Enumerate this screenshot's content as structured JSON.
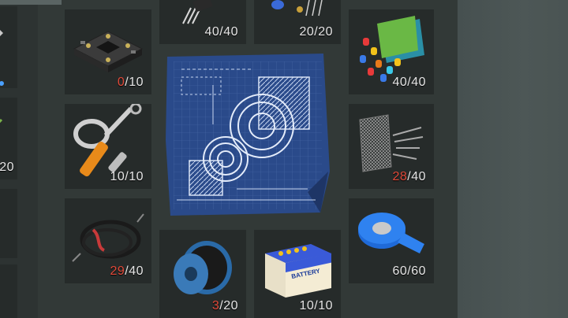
{
  "left_column": {
    "partial_count": "20"
  },
  "slots": [
    {
      "id": "transistors",
      "cur": "40",
      "max": "40",
      "low": false,
      "icon": "transistors-icon"
    },
    {
      "id": "capacitors",
      "cur": "20",
      "max": "20",
      "low": false,
      "icon": "capacitors-icon"
    },
    {
      "id": "circuit-board",
      "cur": "0",
      "max": "10",
      "low": true,
      "icon": "circuit-board-icon"
    },
    {
      "id": "plastic",
      "cur": "40",
      "max": "40",
      "low": false,
      "icon": "plastic-pieces-icon"
    },
    {
      "id": "hydraulics",
      "cur": "10",
      "max": "10",
      "low": false,
      "icon": "hydraulic-cylinder-icon"
    },
    {
      "id": "mesh",
      "cur": "28",
      "max": "40",
      "low": true,
      "icon": "wire-mesh-icon"
    },
    {
      "id": "cables",
      "cur": "29",
      "max": "40",
      "low": true,
      "icon": "cables-icon"
    },
    {
      "id": "wire-spool",
      "cur": "3",
      "max": "20",
      "low": true,
      "icon": "wire-spool-icon"
    },
    {
      "id": "battery",
      "cur": "10",
      "max": "10",
      "low": false,
      "icon": "battery-icon"
    },
    {
      "id": "tape",
      "cur": "60",
      "max": "60",
      "low": false,
      "icon": "duct-tape-icon"
    }
  ],
  "blueprint": {
    "icon": "blueprint-gears-icon"
  },
  "battery_label": "BATTERY",
  "colors": {
    "low": "#e04a3a",
    "text": "#e6e6e6",
    "slot": "#262b2a",
    "panel": "#323937"
  }
}
